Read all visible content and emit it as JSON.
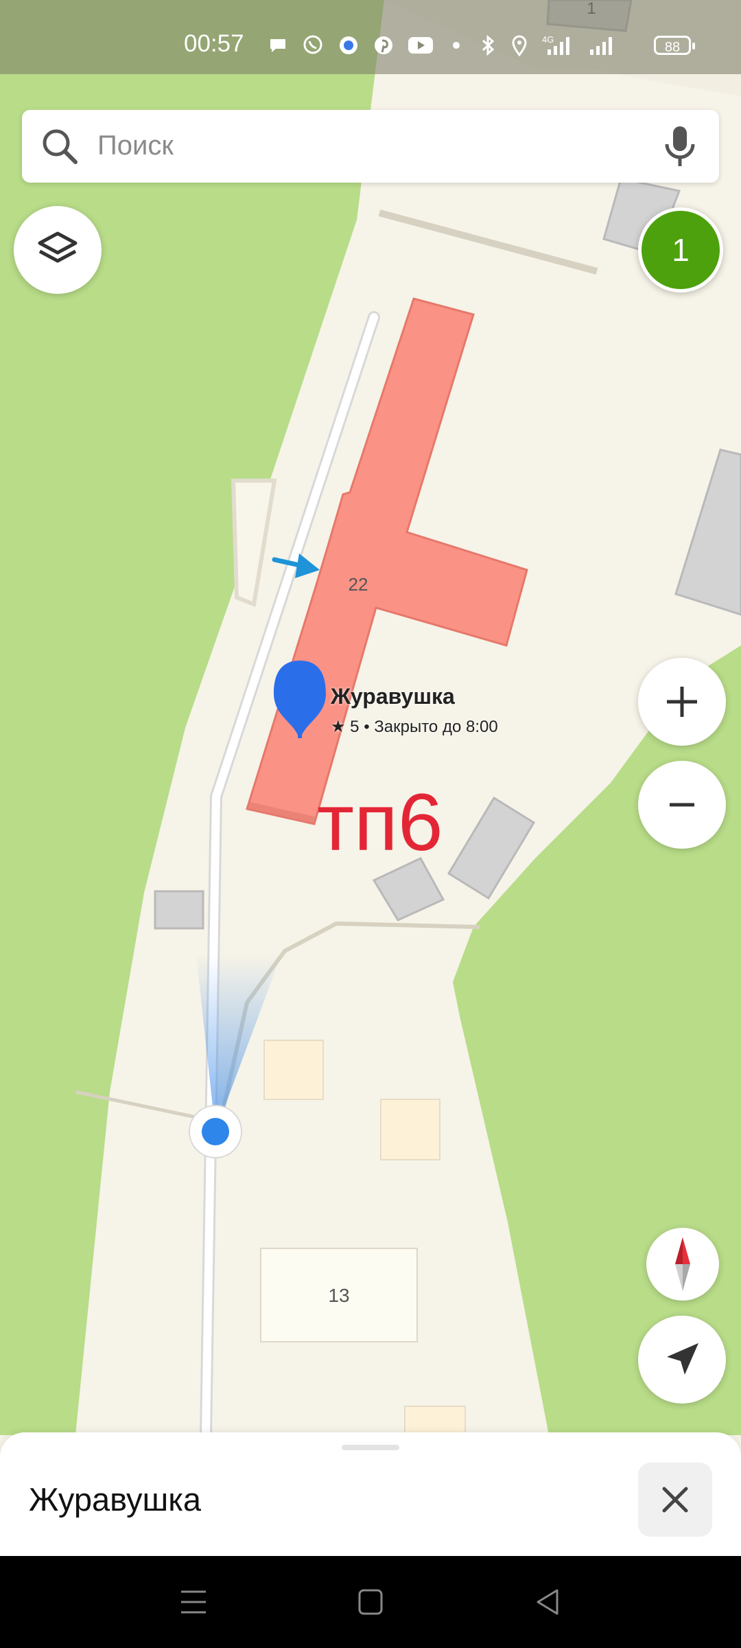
{
  "status_bar": {
    "time": "00:57",
    "battery": "88",
    "network": "4G"
  },
  "search": {
    "placeholder": "Поиск"
  },
  "map": {
    "building_number_main": "22",
    "building_number_lower": "13",
    "building_number_top": "1",
    "poi": {
      "name": "Журавушка",
      "rating_text": "★ 5 • Закрыто до 8:00"
    },
    "annotation_text": "тп6",
    "colors": {
      "green": "#b8dc88",
      "land": "#f6f3e8",
      "building_highlight": "#fa9285",
      "building_gray": "#d3d3d3",
      "pin": "#2b6eea",
      "badge": "#4ca10c",
      "annotation": "#e32636"
    }
  },
  "controls": {
    "layers_icon": "layers-icon",
    "notifications_count": "1",
    "zoom_in_icon": "plus-icon",
    "zoom_out_icon": "minus-icon",
    "compass_icon": "compass-icon",
    "locate_icon": "navigation-arrow-icon"
  },
  "bottom_sheet": {
    "title": "Журавушка",
    "close_icon": "close-icon"
  },
  "nav_bar": {
    "icons": [
      "menu-icon",
      "home-square-icon",
      "back-triangle-icon"
    ]
  }
}
